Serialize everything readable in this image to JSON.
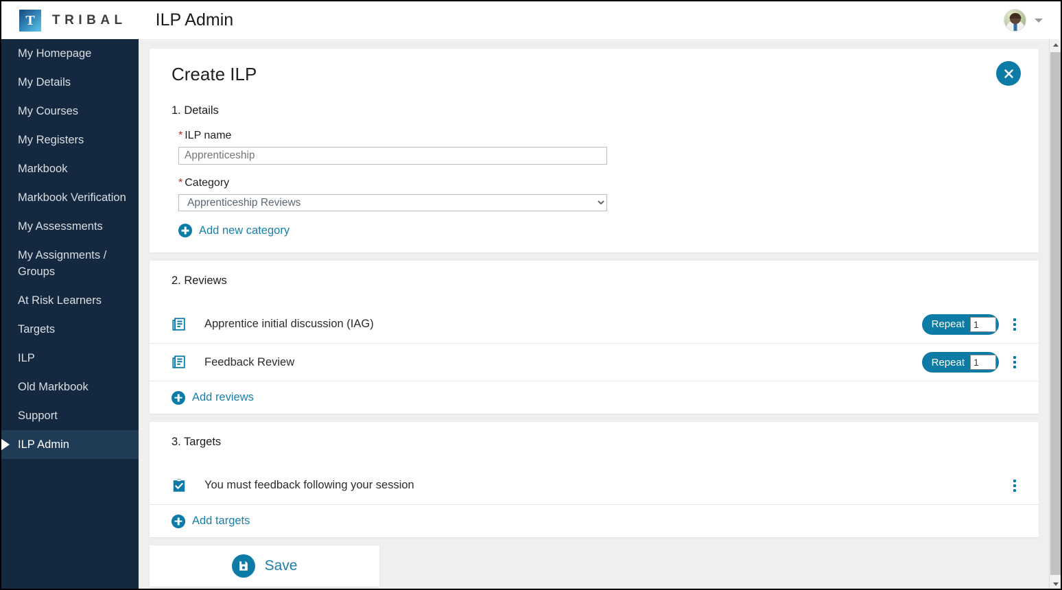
{
  "brand": {
    "logo_letter": "T",
    "logo_word": "TRIBAL",
    "accent_color": "#0c7ba5",
    "sidebar_color": "#14293f",
    "required_color": "#b4232a"
  },
  "header": {
    "app_title": "ILP Admin",
    "avatar_alt": "user-avatar",
    "menu_caret": "chevron-down-icon"
  },
  "sidebar": {
    "items": [
      {
        "label": "My Homepage",
        "active": false
      },
      {
        "label": "My Details",
        "active": false
      },
      {
        "label": "My Courses",
        "active": false
      },
      {
        "label": "My Registers",
        "active": false
      },
      {
        "label": "Markbook",
        "active": false
      },
      {
        "label": "Markbook Verification",
        "active": false
      },
      {
        "label": "My Assessments",
        "active": false
      },
      {
        "label": "My Assignments / Groups",
        "active": false
      },
      {
        "label": "At Risk Learners",
        "active": false
      },
      {
        "label": "Targets",
        "active": false
      },
      {
        "label": "ILP",
        "active": false
      },
      {
        "label": "Old Markbook",
        "active": false
      },
      {
        "label": "Support",
        "active": false
      },
      {
        "label": "ILP Admin",
        "active": true
      }
    ]
  },
  "page": {
    "title": "Create ILP",
    "close_icon": "close-icon"
  },
  "details": {
    "section_title": "1. Details",
    "ilp_name": {
      "label": "ILP name",
      "required": true,
      "required_marker": "*",
      "value": "",
      "placeholder": "Apprenticeship"
    },
    "category": {
      "label": "Category",
      "required": true,
      "required_marker": "*",
      "selected": "Apprenticeship Reviews",
      "options": [
        "Apprenticeship Reviews"
      ]
    },
    "add_category_label": "Add new category"
  },
  "reviews": {
    "section_title": "2. Reviews",
    "items": [
      {
        "label": "Apprentice initial discussion (IAG)",
        "icon": "document-lines-icon",
        "repeat_label": "Repeat",
        "repeat_value": "1"
      },
      {
        "label": "Feedback Review",
        "icon": "document-lines-icon",
        "repeat_label": "Repeat",
        "repeat_value": "1"
      }
    ],
    "add_label": "Add reviews"
  },
  "targets": {
    "section_title": "3. Targets",
    "items": [
      {
        "label": "You must feedback following your session",
        "icon": "clipboard-check-icon"
      }
    ],
    "add_label": "Add targets"
  },
  "footer": {
    "save_label": "Save",
    "save_icon": "floppy-disk-icon"
  }
}
